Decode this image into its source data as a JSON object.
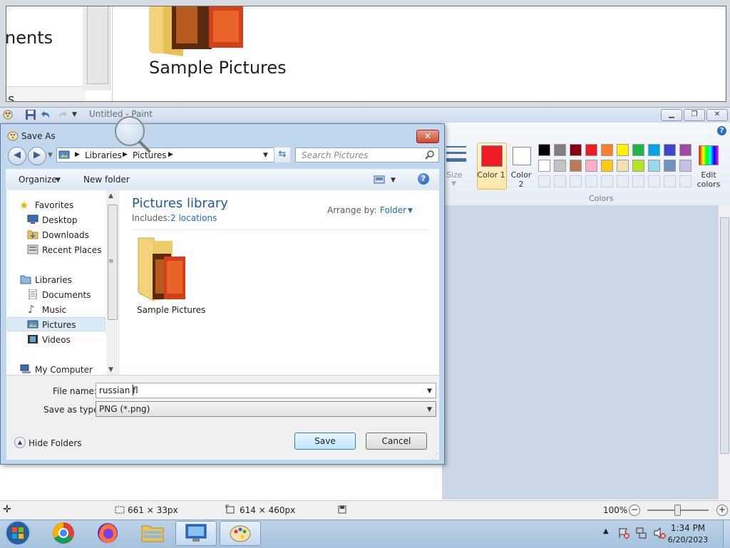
{
  "background_window": {
    "partial_text": "nents",
    "partial_text_2": "s",
    "folder_label": "Sample Pictures"
  },
  "paint": {
    "title": "Untitled - Paint",
    "size_label": "Size",
    "color1_label": "Color 1",
    "color2_label": "Color 2",
    "edit_colors_label": "Edit colors",
    "colors_group_label": "Colors",
    "help": "?",
    "colors": {
      "color1": "#ed1c24",
      "color2": "#ffffff",
      "palette_row1": [
        "#000000",
        "#7f7f7f",
        "#880015",
        "#ed1c24",
        "#ff7f27",
        "#fff200",
        "#22b14c",
        "#00a2e8",
        "#3f48cc",
        "#a349a4"
      ],
      "palette_row2": [
        "#ffffff",
        "#c3c3c3",
        "#b97a57",
        "#ffaec9",
        "#ffc90e",
        "#efe4b0",
        "#b5e61d",
        "#99d9ea",
        "#7092be",
        "#c8bfe7"
      ]
    },
    "status": {
      "selection_size": "661 × 33px",
      "image_size": "614 × 460px",
      "zoom": "100%"
    }
  },
  "dialog": {
    "title": "Save As",
    "breadcrumb": [
      "Libraries",
      "Pictures"
    ],
    "search_placeholder": "Search Pictures",
    "toolbar": {
      "organize": "Organize",
      "new_folder": "New folder"
    },
    "nav": {
      "favorites": "Favorites",
      "favorites_items": [
        "Desktop",
        "Downloads",
        "Recent Places"
      ],
      "libraries": "Libraries",
      "libraries_items": [
        "Documents",
        "Music",
        "Pictures",
        "Videos"
      ],
      "my_computer": "My Computer",
      "selected": "Pictures"
    },
    "content": {
      "library_title": "Pictures library",
      "includes_label": "Includes:",
      "includes_link": "2 locations",
      "arrange_label": "Arrange by:",
      "arrange_value": "Folder",
      "items": [
        {
          "label": "Sample Pictures"
        }
      ]
    },
    "form": {
      "file_name_label": "File name:",
      "file_name_value": "russian fl",
      "save_type_label": "Save as type:",
      "save_type_value": "PNG (*.png)",
      "hide_folders": "Hide Folders",
      "save": "Save",
      "cancel": "Cancel"
    }
  },
  "taskbar": {
    "time": "1:34 PM",
    "date": "6/20/2023",
    "apps": [
      "start",
      "chrome",
      "firefox",
      "explorer",
      "remote-desktop",
      "paint"
    ]
  }
}
